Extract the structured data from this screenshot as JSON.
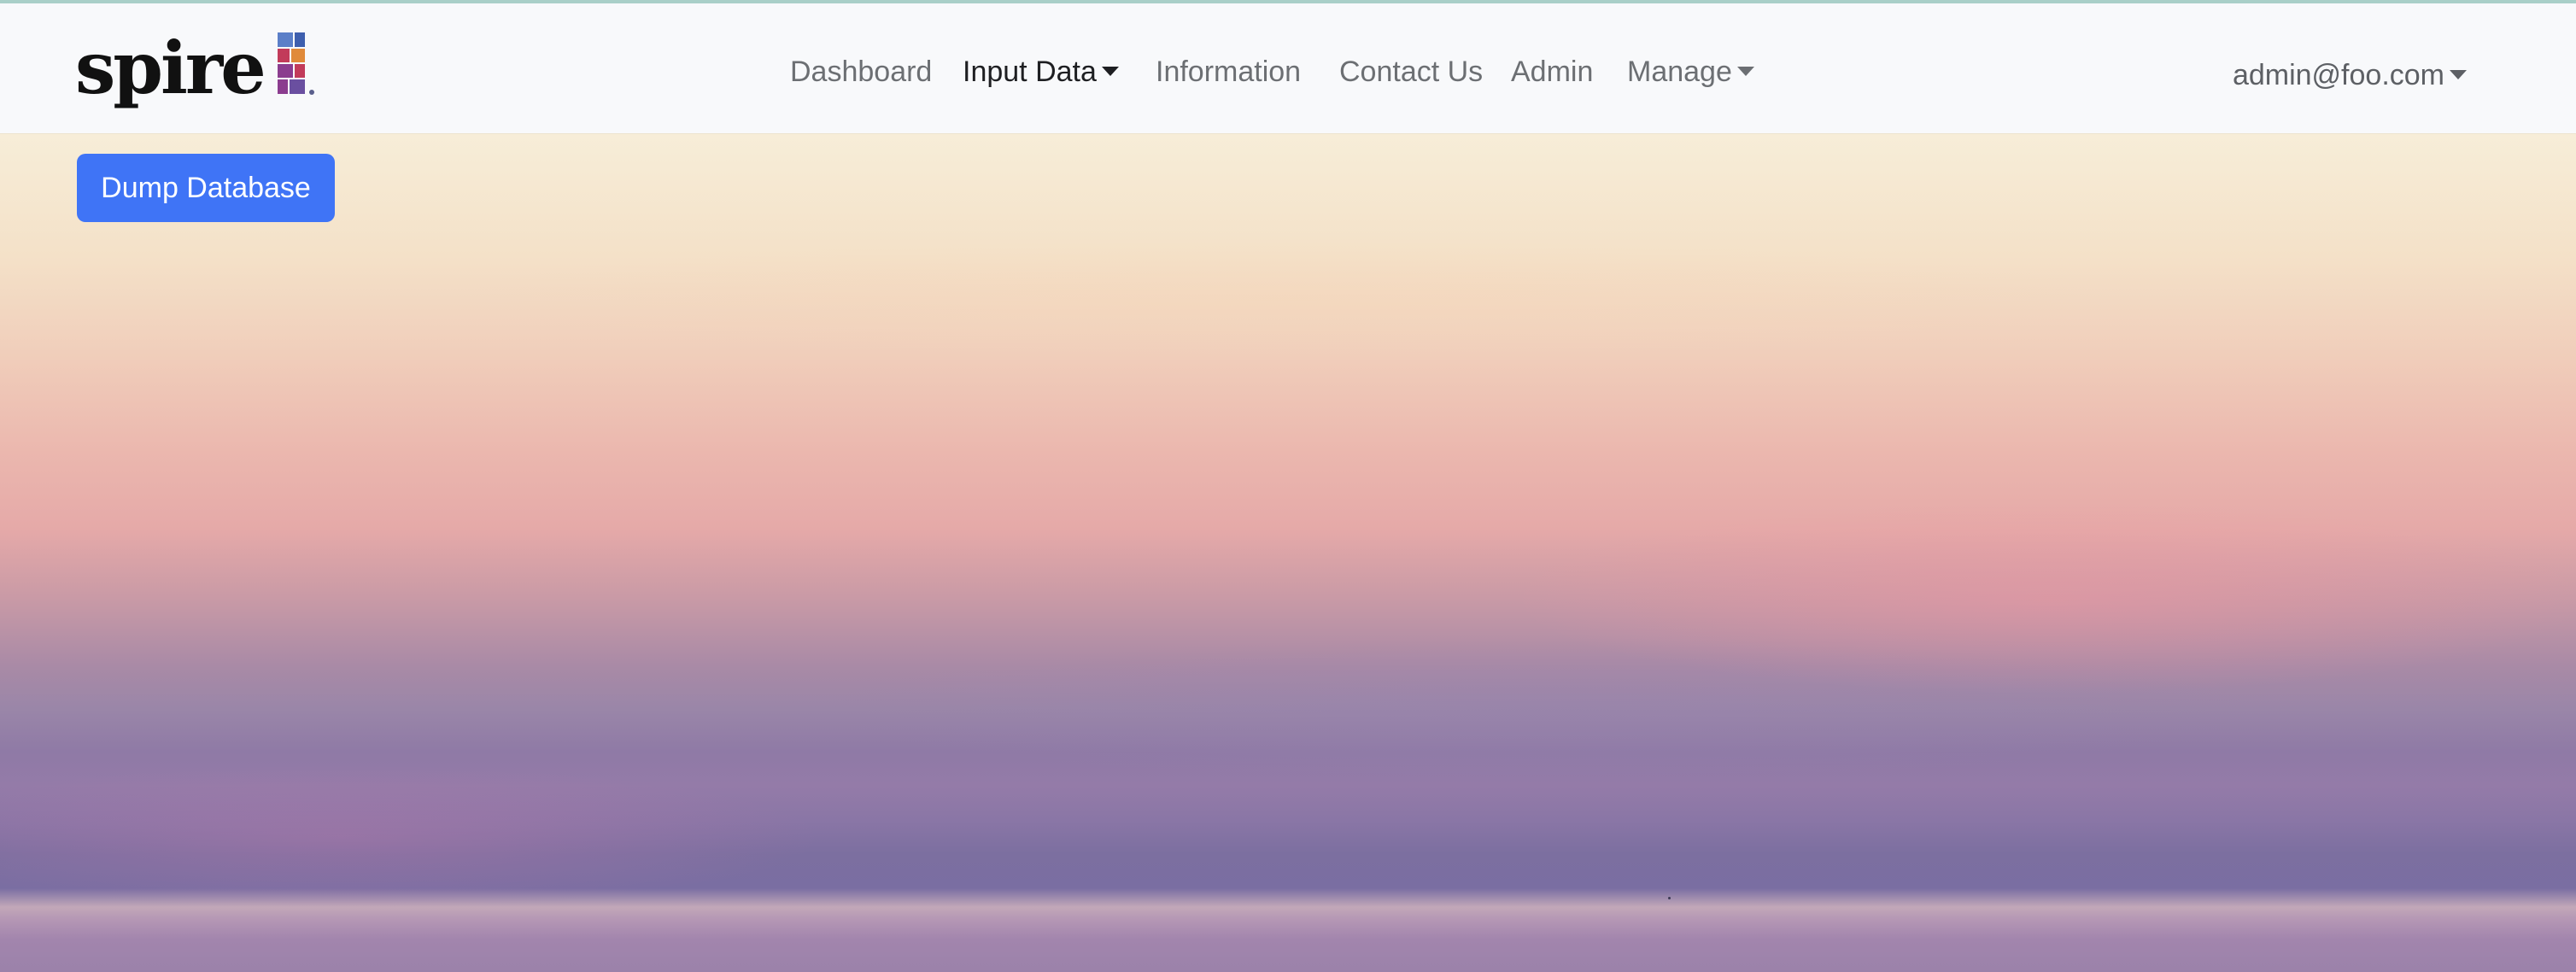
{
  "brand": {
    "name": "spire"
  },
  "nav": {
    "items": [
      {
        "label": "Dashboard",
        "dropdown": false,
        "active": false
      },
      {
        "label": "Input Data",
        "dropdown": true,
        "active": true
      },
      {
        "label": "Information",
        "dropdown": false,
        "active": false
      },
      {
        "label": "Contact Us",
        "dropdown": false,
        "active": false
      },
      {
        "label": "Admin",
        "dropdown": false,
        "active": false
      },
      {
        "label": "Manage",
        "dropdown": true,
        "active": false
      }
    ],
    "user": "admin@foo.com"
  },
  "main": {
    "dump_button_label": "Dump Database"
  },
  "colors": {
    "primary_button": "#3f74f6",
    "navbar_bg": "#f8f9fb",
    "logo_colors": [
      "#5b7fc8",
      "#e08a3a",
      "#8b3c8f",
      "#c23b5a",
      "#3e5fae"
    ]
  }
}
